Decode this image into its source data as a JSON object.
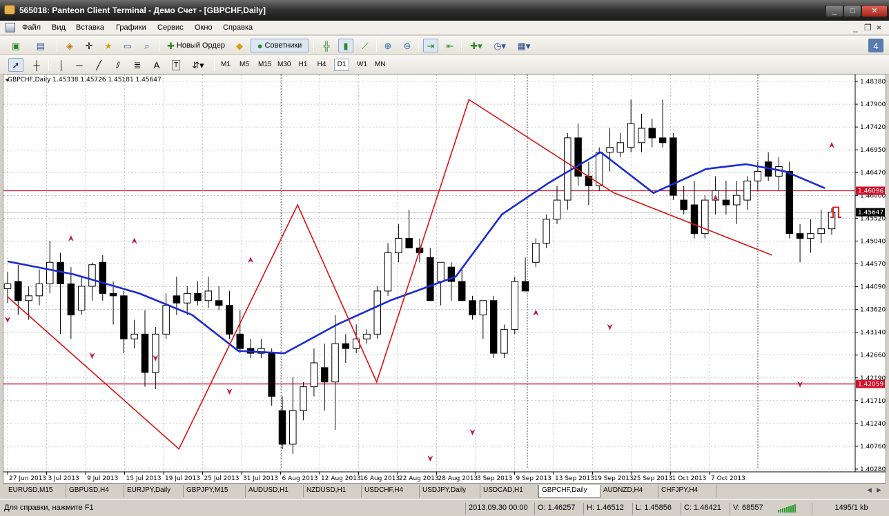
{
  "window": {
    "title": "565018: Panteon Client Terminal - Демо Счет - [GBPCHF,Daily]",
    "min": "_",
    "max": "□",
    "close": "✕"
  },
  "menu": {
    "items": [
      "Файл",
      "Вид",
      "Вставка",
      "Графики",
      "Сервис",
      "Окно",
      "Справка"
    ],
    "mdi_min": "_",
    "mdi_restore": "❐",
    "mdi_close": "×"
  },
  "toolbar1": {
    "new_order": "Новый Ордер",
    "advisors": "Советники"
  },
  "toolbar2": {
    "text_tool": "A",
    "label_tool": "T",
    "timeframes": [
      "M1",
      "M5",
      "M15",
      "M30",
      "H1",
      "H4",
      "D1",
      "W1",
      "MN"
    ],
    "active_timeframe": "D1"
  },
  "chart_data": {
    "type": "candlestick",
    "header": "GBPCHF,Daily  1.45338 1.45726 1.45181 1.45647",
    "price_axis": [
      "1.48380",
      "1.47900",
      "1.47420",
      "1.46950",
      "1.46470",
      "1.46000",
      "1.45520",
      "1.45040",
      "1.44570",
      "1.44090",
      "1.43620",
      "1.43140",
      "1.42660",
      "1.42190",
      "1.41710",
      "1.41240",
      "1.40760",
      "1.40280"
    ],
    "ylim": [
      1.4028,
      1.4838
    ],
    "date_axis": [
      "27 Jun 2013",
      "3 Jul 2013",
      "9 Jul 2013",
      "15 Jul 2013",
      "19 Jul 2013",
      "25 Jul 2013",
      "31 Jul 2013",
      "6 Aug 2013",
      "12 Aug 2013",
      "16 Aug 2013",
      "22 Aug 2013",
      "28 Aug 2013",
      "3 Sep 2013",
      "9 Sep 2013",
      "13 Sep 2013",
      "19 Sep 2013",
      "25 Sep 2013",
      "1 Oct 2013",
      "7 Oct 2013"
    ],
    "hlines": [
      {
        "price": 1.46096,
        "label": "1.46096",
        "color": "#d2102a"
      },
      {
        "price": 1.42059,
        "label": "1.42059",
        "color": "#d2102a"
      },
      {
        "price": 1.45647,
        "label": "1.45647",
        "color": "#000000"
      }
    ],
    "candles": [
      [
        1.4405,
        1.444,
        1.4375,
        1.4415
      ],
      [
        1.442,
        1.4455,
        1.435,
        1.438
      ],
      [
        1.438,
        1.441,
        1.434,
        1.439
      ],
      [
        1.439,
        1.4445,
        1.437,
        1.4415
      ],
      [
        1.4415,
        1.4505,
        1.4395,
        1.446
      ],
      [
        1.446,
        1.448,
        1.431,
        1.4415
      ],
      [
        1.4415,
        1.445,
        1.43,
        1.435
      ],
      [
        1.436,
        1.443,
        1.435,
        1.441
      ],
      [
        1.441,
        1.446,
        1.438,
        1.4455
      ],
      [
        1.446,
        1.4475,
        1.438,
        1.4395
      ],
      [
        1.4395,
        1.442,
        1.433,
        1.439
      ],
      [
        1.439,
        1.44,
        1.427,
        1.43
      ],
      [
        1.43,
        1.434,
        1.428,
        1.431
      ],
      [
        1.431,
        1.436,
        1.42,
        1.423
      ],
      [
        1.423,
        1.4325,
        1.4195,
        1.431
      ],
      [
        1.431,
        1.4395,
        1.43,
        1.437
      ],
      [
        1.439,
        1.443,
        1.435,
        1.4375
      ],
      [
        1.4375,
        1.441,
        1.435,
        1.4395
      ],
      [
        1.4395,
        1.442,
        1.437,
        1.438
      ],
      [
        1.438,
        1.443,
        1.4365,
        1.44
      ],
      [
        1.438,
        1.441,
        1.436,
        1.437
      ],
      [
        1.437,
        1.44,
        1.43,
        1.431
      ],
      [
        1.431,
        1.436,
        1.427,
        1.428
      ],
      [
        1.428,
        1.43,
        1.426,
        1.427
      ],
      [
        1.427,
        1.43,
        1.426,
        1.428
      ],
      [
        1.427,
        1.428,
        1.416,
        1.418
      ],
      [
        1.415,
        1.418,
        1.407,
        1.408
      ],
      [
        1.408,
        1.422,
        1.406,
        1.415
      ],
      [
        1.415,
        1.421,
        1.413,
        1.42
      ],
      [
        1.42,
        1.428,
        1.418,
        1.425
      ],
      [
        1.424,
        1.429,
        1.415,
        1.421
      ],
      [
        1.421,
        1.435,
        1.411,
        1.429
      ],
      [
        1.429,
        1.431,
        1.425,
        1.428
      ],
      [
        1.428,
        1.433,
        1.427,
        1.43
      ],
      [
        1.43,
        1.432,
        1.429,
        1.431
      ],
      [
        1.431,
        1.441,
        1.43,
        1.44
      ],
      [
        1.44,
        1.45,
        1.439,
        1.448
      ],
      [
        1.448,
        1.454,
        1.446,
        1.451
      ],
      [
        1.451,
        1.457,
        1.449,
        1.449
      ],
      [
        1.449,
        1.451,
        1.446,
        1.448
      ],
      [
        1.447,
        1.449,
        1.438,
        1.438
      ],
      [
        1.442,
        1.445,
        1.437,
        1.446
      ],
      [
        1.445,
        1.446,
        1.438,
        1.442
      ],
      [
        1.442,
        1.445,
        1.438,
        1.438
      ],
      [
        1.438,
        1.439,
        1.434,
        1.435
      ],
      [
        1.435,
        1.438,
        1.43,
        1.438
      ],
      [
        1.438,
        1.439,
        1.426,
        1.427
      ],
      [
        1.427,
        1.433,
        1.426,
        1.432
      ],
      [
        1.432,
        1.443,
        1.431,
        1.442
      ],
      [
        1.442,
        1.447,
        1.44,
        1.44
      ],
      [
        1.446,
        1.451,
        1.445,
        1.45
      ],
      [
        1.45,
        1.456,
        1.449,
        1.455
      ],
      [
        1.455,
        1.462,
        1.454,
        1.459
      ],
      [
        1.459,
        1.473,
        1.457,
        1.472
      ],
      [
        1.472,
        1.475,
        1.462,
        1.464
      ],
      [
        1.464,
        1.467,
        1.458,
        1.462
      ],
      [
        1.462,
        1.47,
        1.461,
        1.469
      ],
      [
        1.469,
        1.474,
        1.465,
        1.47
      ],
      [
        1.469,
        1.473,
        1.468,
        1.471
      ],
      [
        1.47,
        1.48,
        1.469,
        1.475
      ],
      [
        1.471,
        1.477,
        1.469,
        1.474
      ],
      [
        1.474,
        1.476,
        1.47,
        1.472
      ],
      [
        1.472,
        1.48,
        1.47,
        1.471
      ],
      [
        1.472,
        1.473,
        1.459,
        1.46
      ],
      [
        1.459,
        1.462,
        1.456,
        1.457
      ],
      [
        1.458,
        1.463,
        1.451,
        1.452
      ],
      [
        1.452,
        1.46,
        1.451,
        1.459
      ],
      [
        1.459,
        1.464,
        1.456,
        1.461
      ],
      [
        1.459,
        1.463,
        1.456,
        1.458
      ],
      [
        1.458,
        1.463,
        1.454,
        1.46
      ],
      [
        1.459,
        1.464,
        1.457,
        1.463
      ],
      [
        1.463,
        1.467,
        1.461,
        1.465
      ],
      [
        1.467,
        1.469,
        1.463,
        1.464
      ],
      [
        1.464,
        1.468,
        1.461,
        1.466
      ],
      [
        1.465,
        1.467,
        1.451,
        1.452
      ],
      [
        1.452,
        1.454,
        1.446,
        1.451
      ],
      [
        1.451,
        1.455,
        1.448,
        1.452
      ],
      [
        1.452,
        1.457,
        1.45,
        1.453
      ],
      [
        1.453,
        1.4573,
        1.4518,
        1.4565
      ]
    ],
    "moving_average": [
      [
        0,
        1.4462
      ],
      [
        10,
        1.4435
      ],
      [
        20,
        1.4395
      ],
      [
        28,
        1.435
      ],
      [
        35,
        1.4275
      ],
      [
        42,
        1.427
      ],
      [
        50,
        1.433
      ],
      [
        58,
        1.438
      ],
      [
        68,
        1.443
      ],
      [
        75,
        1.456
      ],
      [
        82,
        1.4625
      ],
      [
        90,
        1.469
      ],
      [
        98,
        1.4605
      ],
      [
        106,
        1.4655
      ],
      [
        112,
        1.4665
      ],
      [
        118,
        1.465
      ],
      [
        124,
        1.4615
      ]
    ],
    "zigzag": [
      [
        0,
        1.4388
      ],
      [
        26,
        1.407
      ],
      [
        44,
        1.458
      ],
      [
        56,
        1.421
      ],
      [
        70,
        1.48
      ],
      [
        92,
        1.4605
      ],
      [
        116,
        1.4475
      ]
    ],
    "zigzag2": [
      [
        0,
        1.4388
      ],
      [
        26,
        1.407
      ],
      [
        44,
        1.458
      ],
      [
        56,
        1.421
      ],
      [
        70,
        1.48
      ],
      [
        92,
        1.4605
      ],
      [
        116,
        1.4475
      ]
    ]
  },
  "tabs": [
    "EURUSD,M15",
    "GBPUSD,H4",
    "EURJPY,Daily",
    "GBPJPY,M15",
    "AUDUSD,H1",
    "NZDUSD,H1",
    "USDCHF,H4",
    "USDJPY,Daily",
    "USDCAD,H1",
    "GBPCHF,Daily",
    "AUDNZD,H4",
    "CHFJPY,H4"
  ],
  "active_tab": "GBPCHF,Daily",
  "status": {
    "help": "Для справки, нажмите F1",
    "datetime": "2013.09.30 00:00",
    "open": "O: 1.46257",
    "high": "H: 1.46512",
    "low": "L: 1.45856",
    "close": "C: 1.46421",
    "volume": "V: 68557",
    "traffic": "1495/1 kb"
  }
}
